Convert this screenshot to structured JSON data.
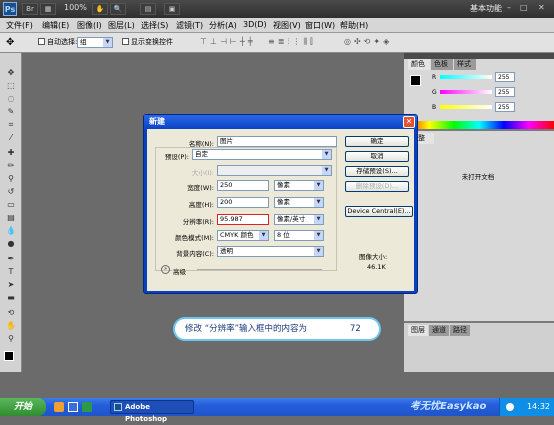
{
  "appbar": {
    "logo": "Ps",
    "zoom": "100%",
    "workspace": "基本功能",
    "controls": [
      "–",
      "□",
      "✕"
    ]
  },
  "menu": [
    "文件(F)",
    "编辑(E)",
    "图像(I)",
    "图层(L)",
    "选择(S)",
    "滤镜(T)",
    "分析(A)",
    "3D(D)",
    "视图(V)",
    "窗口(W)",
    "帮助(H)"
  ],
  "options": {
    "auto_select": "自动选择:",
    "auto_select_value": "组",
    "show_transform": "显示变换控件"
  },
  "panels": {
    "color_tabs": [
      "颜色",
      "色板",
      "样式"
    ],
    "rgb": [
      {
        "label": "R",
        "value": "255"
      },
      {
        "label": "G",
        "value": "255"
      },
      {
        "label": "B",
        "value": "255"
      }
    ],
    "adjust_tab": "调整",
    "no_doc": "未打开文档",
    "bottom_tabs": [
      "图层",
      "通道",
      "路径"
    ]
  },
  "dialog": {
    "title": "新建",
    "name_label": "名称(N):",
    "name_value": "图片",
    "preset_label": "预设(P):",
    "preset_value": "自定",
    "size_label": "大小(I):",
    "width_label": "宽度(W):",
    "width_value": "250",
    "width_unit": "像素",
    "height_label": "高度(H):",
    "height_value": "200",
    "height_unit": "像素",
    "res_label": "分辨率(R):",
    "res_value": "95.987",
    "res_unit": "像素/英寸",
    "mode_label": "颜色模式(M):",
    "mode_value": "CMYK 颜色",
    "mode_bits": "8 位",
    "bg_label": "背景内容(C):",
    "bg_value": "透明",
    "advanced": "高级",
    "ok": "确定",
    "cancel": "取消",
    "save_preset": "存储预设(S)...",
    "delete_preset": "删除预设(D)...",
    "device_central": "Device Central(E)...",
    "image_size_label": "图像大小:",
    "image_size_value": "46.1K"
  },
  "tip": {
    "text": "修改 “分辨率”输入框中的内容为",
    "value": "72"
  },
  "taskbar": {
    "start": "开始",
    "task": "Adobe Photoshop",
    "watermark": "考无忧Easykao",
    "time": "14:32"
  }
}
